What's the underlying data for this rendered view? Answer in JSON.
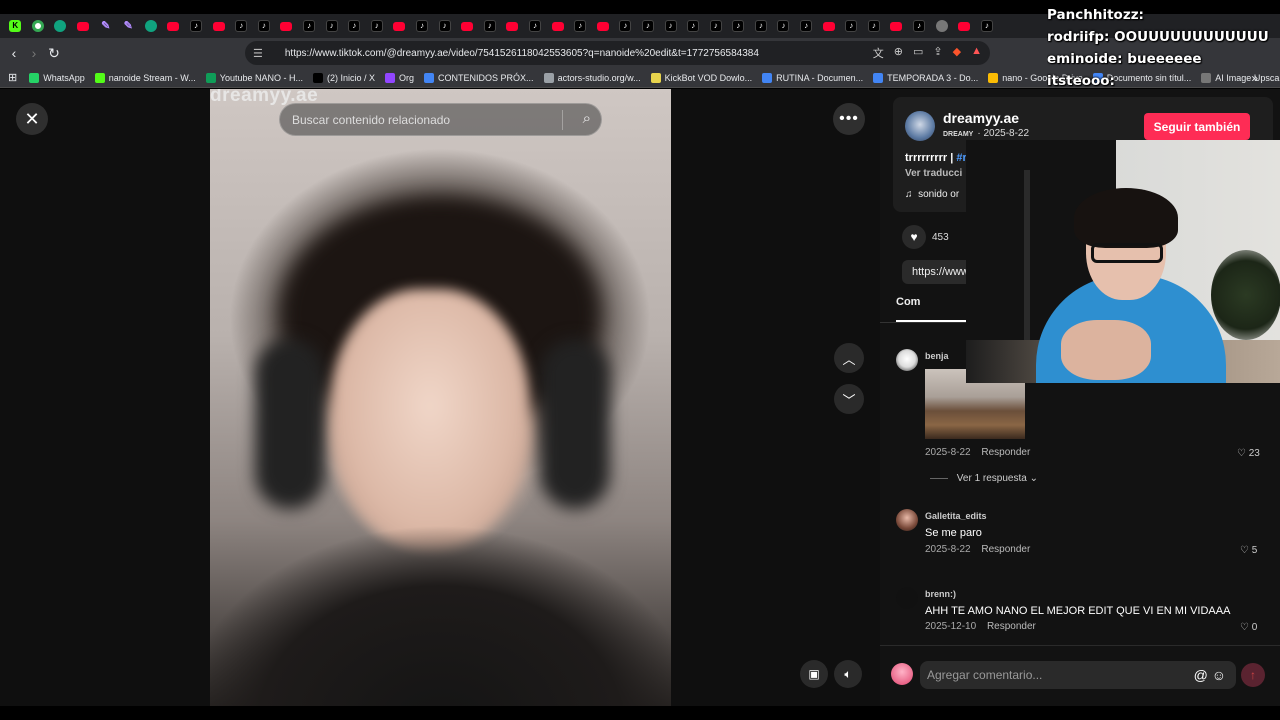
{
  "browser": {
    "tab_icons": [
      "kick",
      "chrome",
      "gpt",
      "youtube",
      "feather",
      "feather",
      "gpt",
      "youtube",
      "tiktok",
      "youtube",
      "tiktok",
      "tiktok",
      "youtube",
      "tiktok",
      "tiktok",
      "tiktok",
      "tiktok",
      "youtube",
      "tiktok",
      "tiktok",
      "youtube",
      "tiktok",
      "youtube",
      "tiktok",
      "youtube",
      "tiktok",
      "youtube",
      "tiktok",
      "tiktok",
      "tiktok",
      "tiktok",
      "tiktok",
      "tiktok",
      "tiktok",
      "tiktok",
      "tiktok",
      "youtube",
      "tiktok",
      "tiktok",
      "youtube",
      "tiktok",
      "globe",
      "youtube",
      "tiktok"
    ],
    "url": "https://www.tiktok.com/@dreamyy.ae/video/7541526118042553605?q=nanoide%20edit&t=1772756584384",
    "bookmarks": [
      {
        "label": "WhatsApp",
        "color": "#25d366"
      },
      {
        "label": "nanoide Stream - W...",
        "color": "#53fc18"
      },
      {
        "label": "Youtube NANO - H...",
        "color": "#0f9d58"
      },
      {
        "label": "(2) Inicio / X",
        "color": "#000000"
      },
      {
        "label": "Org",
        "color": "#9146ff"
      },
      {
        "label": "CONTENIDOS PRÓX...",
        "color": "#4285f4"
      },
      {
        "label": "actors-studio.org/w...",
        "color": "#9aa0a6"
      },
      {
        "label": "KickBot VOD Dowlo...",
        "color": "#e8d44d"
      },
      {
        "label": "RUTINA - Documen...",
        "color": "#4285f4"
      },
      {
        "label": "TEMPORADA 3 - Do...",
        "color": "#4285f4"
      },
      {
        "label": "nano - Google Drive",
        "color": "#fbbc04"
      },
      {
        "label": "Documento sin títul...",
        "color": "#4285f4"
      },
      {
        "label": "AI Image Upscaler |...",
        "color": "#777777"
      }
    ]
  },
  "video": {
    "watermark": "dreamyy.ae",
    "search_placeholder": "Buscar contenido relacionado"
  },
  "author": {
    "username": "dreamyy.ae",
    "nickname": "DREAMY",
    "date": "2025-8-22",
    "follow_label": "Seguir también",
    "description": "trrrrrrrrr | ",
    "hashtag": "#r",
    "translate": "Ver traducci",
    "sound": "sonido or",
    "likes": "453",
    "share_url": "https://www.",
    "tab_label": "Com"
  },
  "comments": [
    {
      "name": "benja",
      "text": "",
      "date": "2025-8-22",
      "reply": "Responder",
      "likes": "23",
      "has_image": true,
      "view_replies": "Ver 1 respuesta"
    },
    {
      "name": "Galletita_edits",
      "text": "Se me paro",
      "date": "2025-8-22",
      "reply": "Responder",
      "likes": "5"
    },
    {
      "name": "brenn:)",
      "text": "AHH TE AMO NANO EL MEJOR EDIT QUE VI EN MI VIDAAA",
      "date": "2025-12-10",
      "reply": "Responder",
      "likes": "0"
    }
  ],
  "comment_input": {
    "placeholder": "Agregar comentario..."
  },
  "chat": [
    {
      "user": "Panchhitozz:",
      "message": ""
    },
    {
      "user": "rodriifp:",
      "message": "OOUUUUUUUUUUUU"
    },
    {
      "user": "eminoide:",
      "message": "bueeeeee"
    },
    {
      "user": "itsteooo:",
      "message": ""
    }
  ]
}
